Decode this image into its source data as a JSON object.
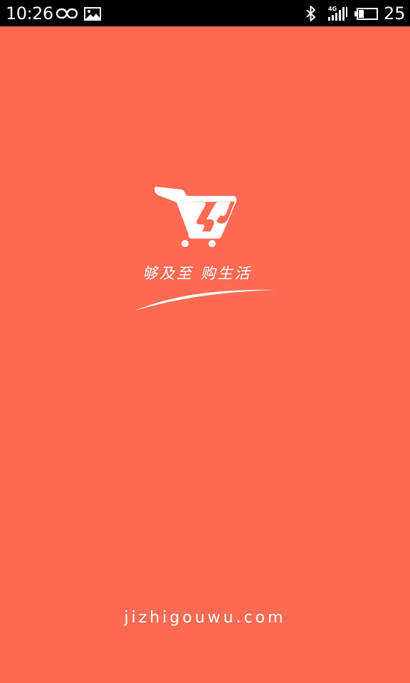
{
  "status_bar": {
    "time": "10:26",
    "network": "4G",
    "battery_level": "25",
    "icons": [
      "infinity-icon",
      "image-icon",
      "bluetooth-icon",
      "signal-icon",
      "battery-icon"
    ]
  },
  "splash": {
    "logo_icon": "shopping-cart-logo",
    "slogan": "够及至 购生活",
    "url": "jizhigouwu.com"
  },
  "colors": {
    "background": "#ff6a53",
    "status_bar": "#000000",
    "foreground": "#ffffff"
  }
}
